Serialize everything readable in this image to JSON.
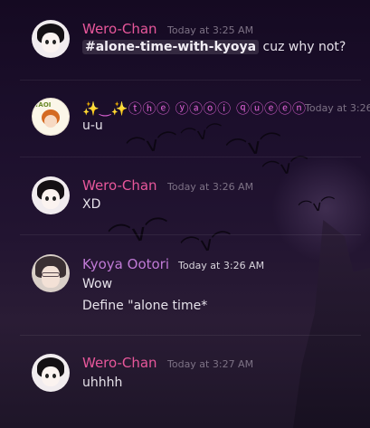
{
  "messages": [
    {
      "author": "Wero-Chan",
      "author_color": "#e8579b",
      "timestamp": "Today at 3:25 AM",
      "lines": [
        {
          "mention": "#alone-time-with-kyoya",
          "text": "cuz why not?"
        }
      ]
    },
    {
      "author": "✨‿✨ⓣⓗⓔ ⓨⓐⓞⓘ ⓠⓤⓔⓔⓝ",
      "author_color": "#d85fd0",
      "timestamp": "Today at 3:26",
      "lines": [
        {
          "text": "u-u"
        }
      ]
    },
    {
      "author": "Wero-Chan",
      "author_color": "#e8579b",
      "timestamp": "Today at 3:26 AM",
      "lines": [
        {
          "text": "XD"
        }
      ]
    },
    {
      "author": "Kyoya Ootori",
      "author_color": "#c07ad6",
      "timestamp": "Today at 3:26 AM",
      "lines": [
        {
          "text": "Wow"
        },
        {
          "text": "Define \"alone time*"
        }
      ]
    },
    {
      "author": "Wero-Chan",
      "author_color": "#e8579b",
      "timestamp": "Today at 3:27 AM",
      "lines": [
        {
          "text": "uhhhh"
        }
      ]
    }
  ],
  "avatars": {
    "queen_tag": "YAOI"
  }
}
